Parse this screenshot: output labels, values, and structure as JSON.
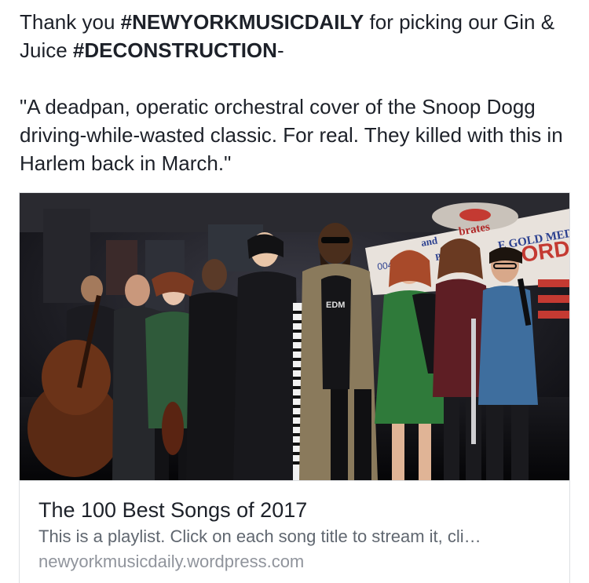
{
  "post": {
    "line1_prefix": "Thank you ",
    "hashtag1": "#NEWYORKMUSICDAILY",
    "line1_suffix": " for picking our Gin & Juice ",
    "hashtag2": "#DECONSTRUCTION",
    "line1_end": "-",
    "quote": "\"A deadpan, operatic orchestral cover of the Snoop Dogg driving-while-wasted classic. For real. They killed with this in Harlem back in March.\""
  },
  "link_card": {
    "photo": {
      "banner_line1": "brates",
      "banner_line2": "E GOLD MED",
      "banner_line3": "ORD",
      "banner_line4": "and",
      "banner_line5": "PIC",
      "banner_line6": "004",
      "shirt_print": "EDM"
    },
    "title": "The 100 Best Songs of 2017",
    "description": "This is a playlist. Click on each song title to stream it, cli…",
    "domain": "newyorkmusicdaily.wordpress.com"
  }
}
